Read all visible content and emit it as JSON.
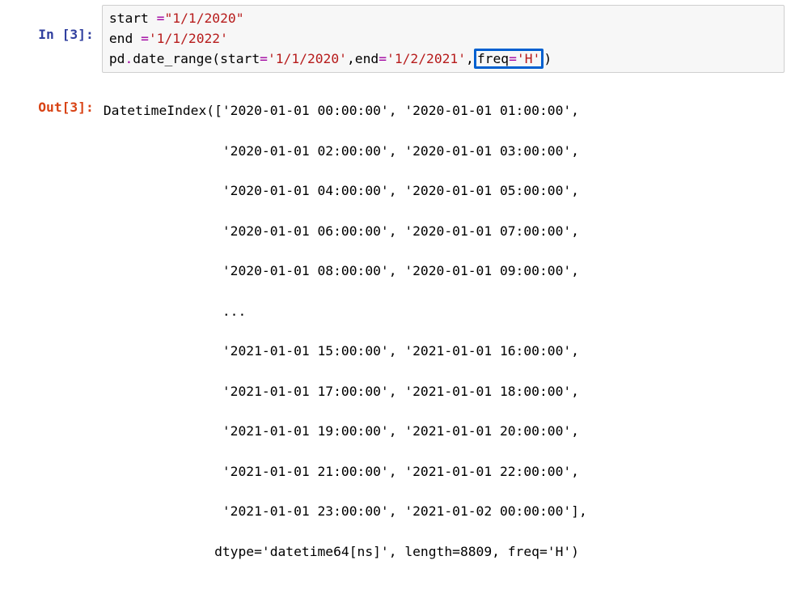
{
  "in_prompt": "In [3]:",
  "out_prompt": "Out[3]:",
  "code": {
    "line1": {
      "lhs": "start ",
      "eq": "=",
      "str": "\"1/1/2020\""
    },
    "line2": {
      "lhs": "end ",
      "eq": "=",
      "str": "'1/1/2022'"
    },
    "line3": {
      "obj": "pd",
      "dot": ".",
      "fn": "date_range",
      "open": "(",
      "kw1": "start",
      "eq1": "=",
      "v1": "'1/1/2020'",
      "c1": ",",
      "kw2": "end",
      "eq2": "=",
      "v2": "'1/2/2021'",
      "c2": ",",
      "kw3": "freq",
      "eq3": "=",
      "v3": "'H'",
      "close": ")"
    }
  },
  "out": {
    "l01": "DatetimeIndex(['2020-01-01 00:00:00', '2020-01-01 01:00:00',",
    "l02": "               '2020-01-01 02:00:00', '2020-01-01 03:00:00',",
    "l03": "               '2020-01-01 04:00:00', '2020-01-01 05:00:00',",
    "l04": "               '2020-01-01 06:00:00', '2020-01-01 07:00:00',",
    "l05": "               '2020-01-01 08:00:00', '2020-01-01 09:00:00',",
    "l06": "               ...",
    "l07": "               '2021-01-01 15:00:00', '2021-01-01 16:00:00',",
    "l08": "               '2021-01-01 17:00:00', '2021-01-01 18:00:00',",
    "l09": "               '2021-01-01 19:00:00', '2021-01-01 20:00:00',",
    "l10": "               '2021-01-01 21:00:00', '2021-01-01 22:00:00',",
    "l11": "               '2021-01-01 23:00:00', '2021-01-02 00:00:00'],",
    "l12": "              dtype='datetime64[ns]', length=8809, freq='H')"
  }
}
